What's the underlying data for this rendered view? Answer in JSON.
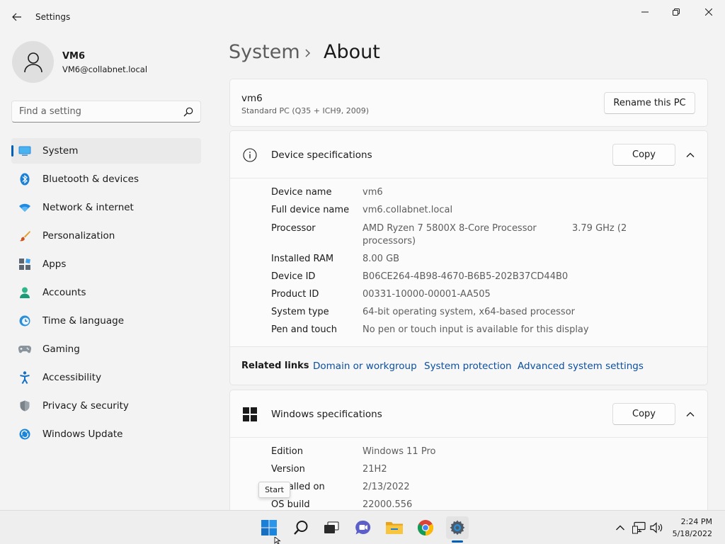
{
  "window": {
    "title": "Settings"
  },
  "user": {
    "name": "VM6",
    "email": "VM6@collabnet.local"
  },
  "search": {
    "placeholder": "Find a setting"
  },
  "nav": {
    "items": [
      {
        "label": "System",
        "icon": "system-icon",
        "selected": true
      },
      {
        "label": "Bluetooth & devices",
        "icon": "bluetooth-icon"
      },
      {
        "label": "Network & internet",
        "icon": "network-icon"
      },
      {
        "label": "Personalization",
        "icon": "brush-icon"
      },
      {
        "label": "Apps",
        "icon": "apps-icon"
      },
      {
        "label": "Accounts",
        "icon": "accounts-icon"
      },
      {
        "label": "Time & language",
        "icon": "time-language-icon"
      },
      {
        "label": "Gaming",
        "icon": "gaming-icon"
      },
      {
        "label": "Accessibility",
        "icon": "accessibility-icon"
      },
      {
        "label": "Privacy & security",
        "icon": "shield-icon"
      },
      {
        "label": "Windows Update",
        "icon": "windows-update-icon"
      }
    ]
  },
  "breadcrumb": {
    "parent": "System",
    "current": "About"
  },
  "pc": {
    "name": "vm6",
    "model": "Standard PC (Q35 + ICH9, 2009)",
    "rename_label": "Rename this PC"
  },
  "device_specs": {
    "title": "Device specifications",
    "copy_label": "Copy",
    "rows": [
      {
        "label": "Device name",
        "value": "vm6"
      },
      {
        "label": "Full device name",
        "value": "vm6.collabnet.local"
      },
      {
        "label": "Processor",
        "value": "AMD Ryzen 7 5800X 8-Core Processor",
        "value2": "processors)",
        "extra": "3.79 GHz  (2"
      },
      {
        "label": "Installed RAM",
        "value": "8.00 GB"
      },
      {
        "label": "Device ID",
        "value": "B06CE264-4B98-4670-B6B5-202B37CD44B0"
      },
      {
        "label": "Product ID",
        "value": "00331-10000-00001-AA505"
      },
      {
        "label": "System type",
        "value": "64-bit operating system, x64-based processor"
      },
      {
        "label": "Pen and touch",
        "value": "No pen or touch input is available for this display"
      }
    ]
  },
  "related_links": {
    "title": "Related links",
    "links": [
      "Domain or workgroup",
      "System protection",
      "Advanced system settings"
    ]
  },
  "windows_specs": {
    "title": "Windows specifications",
    "copy_label": "Copy",
    "rows": [
      {
        "label": "Edition",
        "value": "Windows 11 Pro"
      },
      {
        "label": "Version",
        "value": "21H2"
      },
      {
        "label": "Installed on",
        "value": "2/13/2022"
      },
      {
        "label": "OS build",
        "value": "22000.556"
      }
    ]
  },
  "tooltip": {
    "text": "Start"
  },
  "taskbar": {
    "apps": [
      "start-icon",
      "search-icon",
      "task-view-icon",
      "chat-icon",
      "file-explorer-icon",
      "chrome-icon",
      "settings-icon"
    ],
    "clock": {
      "time": "2:24 PM",
      "date": "5/18/2022"
    }
  },
  "colors": {
    "accent": "#005fb8",
    "link": "#0a4fa3",
    "background": "#f3f3f3",
    "card": "#fbfbfb"
  }
}
